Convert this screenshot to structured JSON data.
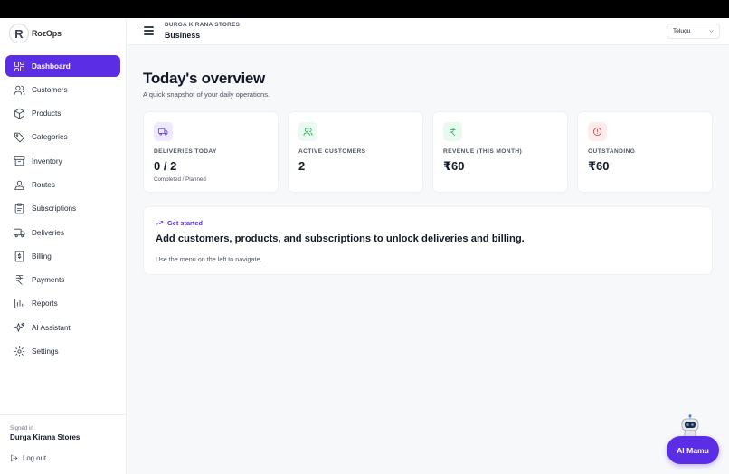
{
  "brand": {
    "logo_text": "RozOps"
  },
  "sidebar": {
    "items": [
      {
        "label": "Dashboard",
        "icon": "dashboard-icon",
        "active": true
      },
      {
        "label": "Customers",
        "icon": "customers-icon"
      },
      {
        "label": "Products",
        "icon": "box-icon"
      },
      {
        "label": "Categories",
        "icon": "tag-icon"
      },
      {
        "label": "Inventory",
        "icon": "archive-icon"
      },
      {
        "label": "Routes",
        "icon": "route-icon"
      },
      {
        "label": "Subscriptions",
        "icon": "clipboard-icon"
      },
      {
        "label": "Deliveries",
        "icon": "truck-icon"
      },
      {
        "label": "Billing",
        "icon": "receipt-icon"
      },
      {
        "label": "Payments",
        "icon": "rupee-icon"
      },
      {
        "label": "Reports",
        "icon": "bar-chart-icon"
      },
      {
        "label": "AI Assistant",
        "icon": "sparkles-icon"
      },
      {
        "label": "Settings",
        "icon": "gear-icon"
      }
    ],
    "footer": {
      "signed_in_label": "Signed in",
      "user_name": "Durga Kirana Stores",
      "logout_label": "Log out"
    }
  },
  "header": {
    "store_name": "DURGA KIRANA STORES",
    "store_type": "Business",
    "language": "Telugu"
  },
  "main": {
    "title": "Today's overview",
    "subtitle": "A quick snapshot of your daily operations.",
    "stats": [
      {
        "label": "DELIVERIES TODAY",
        "value": "0 / 2",
        "note": "Completed / Planned",
        "icon": "truck-icon",
        "color": "#5b2ee6",
        "bg": "#ede9fe"
      },
      {
        "label": "ACTIVE CUSTOMERS",
        "value": "2",
        "note": "",
        "icon": "customers-icon",
        "color": "#16a34a",
        "bg": "#eafaf0"
      },
      {
        "label": "REVENUE (THIS MONTH)",
        "value": "₹60",
        "note": "",
        "icon": "rupee-icon",
        "color": "#16a34a",
        "bg": "#eafaf0"
      },
      {
        "label": "OUTSTANDING",
        "value": "₹60",
        "note": "",
        "icon": "alert-circle-icon",
        "color": "#dc2626",
        "bg": "#fdecec"
      }
    ],
    "get_started": {
      "tag": "Get started",
      "title": "Add customers, products, and subscriptions to unlock deliveries and billing.",
      "note": "Use the menu on the left to navigate."
    }
  },
  "assistant_button": {
    "label": "AI Mamu"
  },
  "colors": {
    "accent": "#5b2ee6"
  }
}
